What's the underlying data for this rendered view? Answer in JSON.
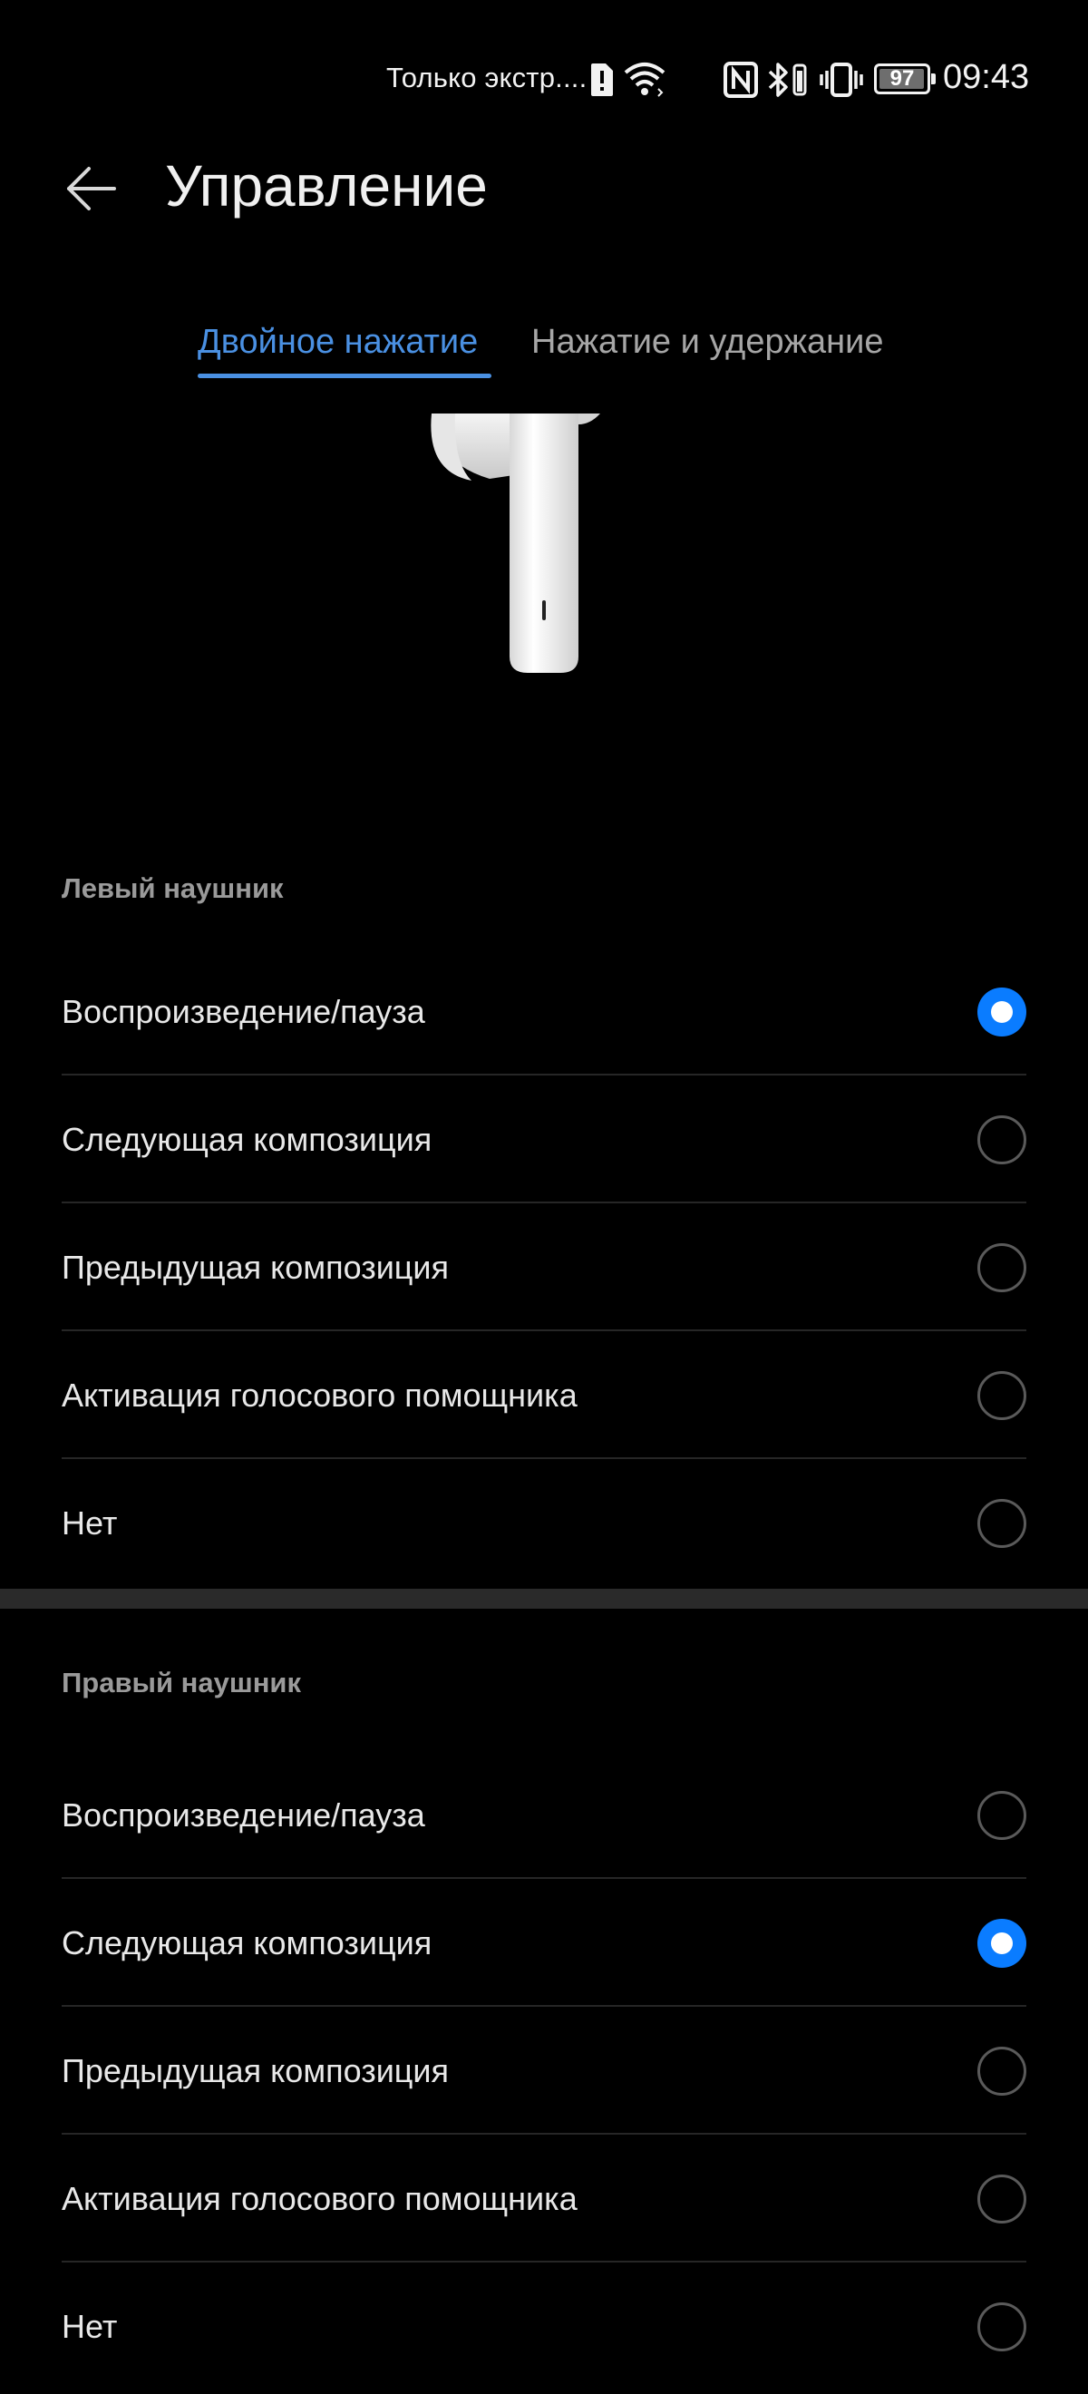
{
  "status_bar": {
    "carrier_text": "Только экстр....",
    "battery_level": "97",
    "time": "09:43",
    "icons": [
      "alert-icon",
      "wifi-icon",
      "nfc-icon",
      "bluetooth-icon",
      "vibrate-icon",
      "battery-icon"
    ]
  },
  "header": {
    "back_icon": "back-arrow-icon",
    "title": "Управление"
  },
  "tabs": [
    {
      "label": "Двойное нажатие",
      "active": true
    },
    {
      "label": "Нажатие и удержание",
      "active": false
    }
  ],
  "left_earbud": {
    "section_label": "Левый наушник",
    "options": [
      {
        "label": "Воспроизведение/пауза",
        "selected": true
      },
      {
        "label": "Следующая композиция",
        "selected": false
      },
      {
        "label": "Предыдущая композиция",
        "selected": false
      },
      {
        "label": "Активация голосового помощника",
        "selected": false
      },
      {
        "label": "Нет",
        "selected": false
      }
    ]
  },
  "right_earbud": {
    "section_label": "Правый наушник",
    "options": [
      {
        "label": "Воспроизведение/пауза",
        "selected": false
      },
      {
        "label": "Следующая композиция",
        "selected": true
      },
      {
        "label": "Предыдущая композиция",
        "selected": false
      },
      {
        "label": "Активация голосового помощника",
        "selected": false
      },
      {
        "label": "Нет",
        "selected": false
      }
    ]
  },
  "colors": {
    "accent": "#0a7cff",
    "tab_active": "#4a90e2",
    "background": "#000000"
  }
}
